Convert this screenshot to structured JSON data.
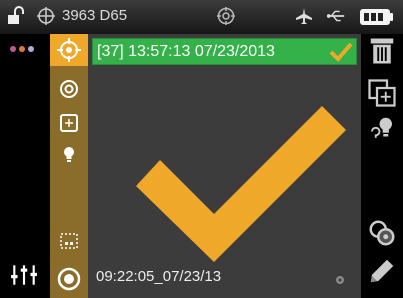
{
  "status_bar": {
    "device_label": "3963 D65",
    "icons": [
      "lock-open-icon",
      "crosshair-icon",
      "target-icon",
      "airplane-icon",
      "usb-icon",
      "battery-icon"
    ]
  },
  "header": {
    "text": "[37] 13:57:13 07/23/2013",
    "status": "pass",
    "accent": "#34b249"
  },
  "measurement": {
    "result_icon": "large-checkmark-icon",
    "result_color": "#f0a82a",
    "timestamp": "09:22:05_07/23/13"
  },
  "left_tools": [
    "colors-dots-icon",
    "crosshair-target-icon",
    "circle-target-icon",
    "grid-icon",
    "bulb-icon",
    "selection-box-icon",
    "sliders-icon",
    "measure-button-icon"
  ],
  "right_actions": [
    "trash-icon",
    "copy-grid-icon",
    "bulb-question-icon",
    "settings-measure-icon",
    "edit-pencil-icon"
  ],
  "colors": {
    "tool_column": "#8a6d2a",
    "tool_selected": "#f0a82a",
    "content_bg": "#3c3c3c"
  }
}
